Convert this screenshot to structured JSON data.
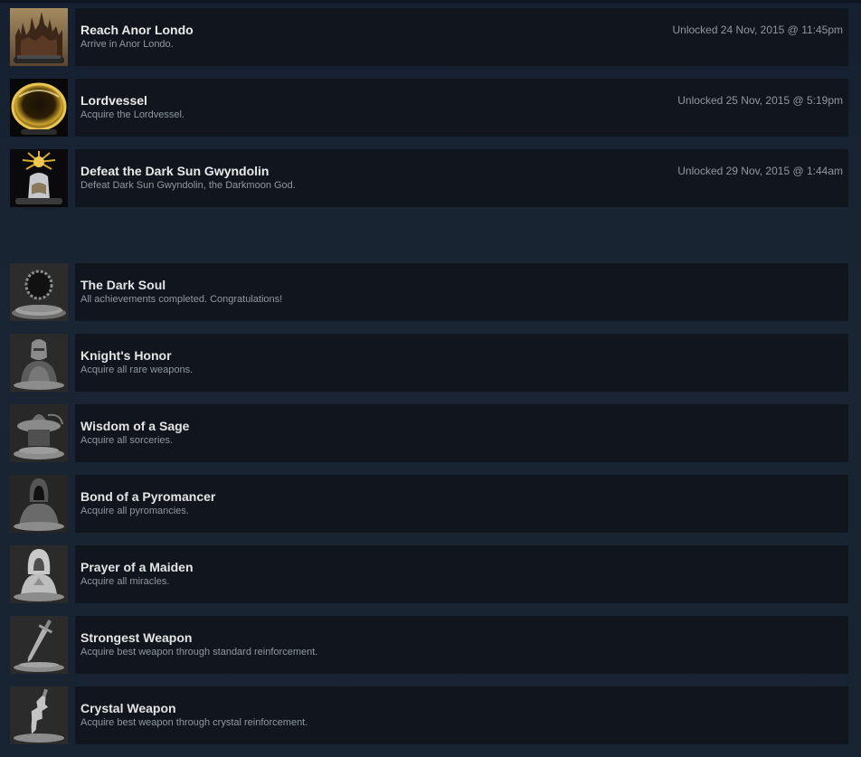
{
  "unlocked": [
    {
      "title": "Reach Anor Londo",
      "description": "Arrive in Anor Londo.",
      "date": "Unlocked 24 Nov, 2015 @ 11:45pm",
      "icon": "castle-icon"
    },
    {
      "title": "Lordvessel",
      "description": "Acquire the Lordvessel.",
      "date": "Unlocked 25 Nov, 2015 @ 5:19pm",
      "icon": "golden-vessel-icon"
    },
    {
      "title": "Defeat the Dark Sun Gwyndolin",
      "description": "Defeat Dark Sun Gwyndolin, the Darkmoon God.",
      "date": "Unlocked 29 Nov, 2015 @ 1:44am",
      "icon": "gwyndolin-icon"
    }
  ],
  "locked": [
    {
      "title": "The Dark Soul",
      "description": "All achievements completed. Congratulations!",
      "icon": "dark-soul-ring-icon"
    },
    {
      "title": "Knight's Honor",
      "description": "Acquire all rare weapons.",
      "icon": "knight-bust-icon"
    },
    {
      "title": "Wisdom of a Sage",
      "description": "Acquire all sorceries.",
      "icon": "sage-hat-icon"
    },
    {
      "title": "Bond of a Pyromancer",
      "description": "Acquire all pyromancies.",
      "icon": "pyromancer-hood-icon"
    },
    {
      "title": "Prayer of a Maiden",
      "description": "Acquire all miracles.",
      "icon": "maiden-praying-icon"
    },
    {
      "title": "Strongest Weapon",
      "description": "Acquire best weapon through standard reinforcement.",
      "icon": "sword-icon"
    },
    {
      "title": "Crystal Weapon",
      "description": "Acquire best weapon through crystal reinforcement.",
      "icon": "crystal-sword-icon"
    }
  ],
  "colors": {
    "background": "#172231",
    "panel": "#11161e",
    "title": "#eaeaea",
    "description": "#8f98a0"
  }
}
